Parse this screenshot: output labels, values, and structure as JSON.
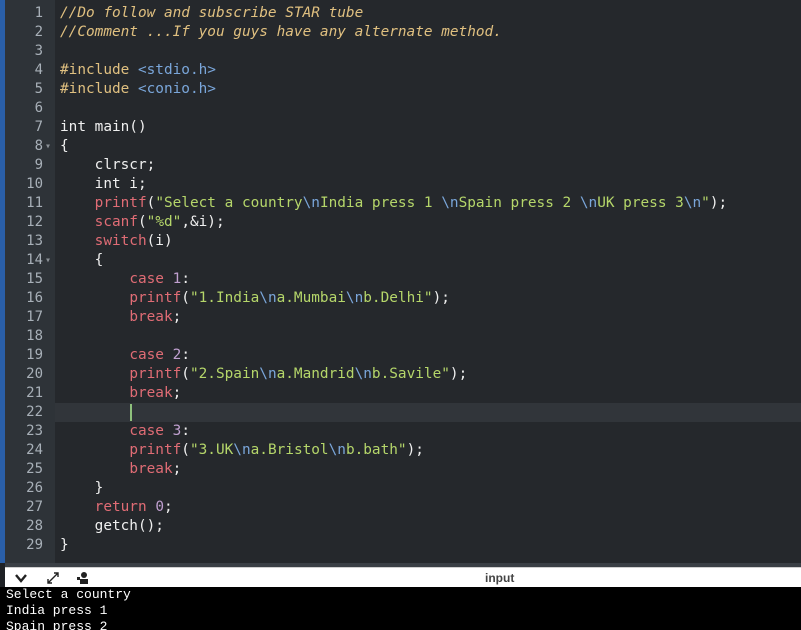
{
  "editor": {
    "lines": [
      {
        "num": "1",
        "tokens": [
          {
            "t": "//Do follow and subscribe STAR tube",
            "c": "comment"
          }
        ]
      },
      {
        "num": "2",
        "tokens": [
          {
            "t": "//Comment ...If you guys have any alternate method.",
            "c": "comment"
          }
        ]
      },
      {
        "num": "3",
        "tokens": []
      },
      {
        "num": "4",
        "tokens": [
          {
            "t": "#include ",
            "c": "pre"
          },
          {
            "t": "<stdio.h>",
            "c": "hdr"
          }
        ]
      },
      {
        "num": "5",
        "tokens": [
          {
            "t": "#include ",
            "c": "pre"
          },
          {
            "t": "<conio.h>",
            "c": "hdr"
          }
        ]
      },
      {
        "num": "6",
        "tokens": []
      },
      {
        "num": "7",
        "tokens": [
          {
            "t": "int main()",
            "c": "plain"
          }
        ]
      },
      {
        "num": "8",
        "fold": true,
        "tokens": [
          {
            "t": "{",
            "c": "plain"
          }
        ]
      },
      {
        "num": "9",
        "tokens": [
          {
            "t": "    clrscr;",
            "c": "plain"
          }
        ]
      },
      {
        "num": "10",
        "tokens": [
          {
            "t": "    int i;",
            "c": "plain"
          }
        ]
      },
      {
        "num": "11",
        "tokens": [
          {
            "t": "    ",
            "c": "plain"
          },
          {
            "t": "printf",
            "c": "fn"
          },
          {
            "t": "(",
            "c": "plain"
          },
          {
            "t": "\"Select a country",
            "c": "str"
          },
          {
            "t": "\\n",
            "c": "esc"
          },
          {
            "t": "India press 1 ",
            "c": "str"
          },
          {
            "t": "\\n",
            "c": "esc"
          },
          {
            "t": "Spain press 2 ",
            "c": "str"
          },
          {
            "t": "\\n",
            "c": "esc"
          },
          {
            "t": "UK press 3",
            "c": "str"
          },
          {
            "t": "\\n",
            "c": "esc"
          },
          {
            "t": "\"",
            "c": "str"
          },
          {
            "t": ");",
            "c": "plain"
          }
        ]
      },
      {
        "num": "12",
        "tokens": [
          {
            "t": "    ",
            "c": "plain"
          },
          {
            "t": "scanf",
            "c": "fn"
          },
          {
            "t": "(",
            "c": "plain"
          },
          {
            "t": "\"%d\"",
            "c": "str"
          },
          {
            "t": ",&i);",
            "c": "plain"
          }
        ]
      },
      {
        "num": "13",
        "tokens": [
          {
            "t": "    ",
            "c": "plain"
          },
          {
            "t": "switch",
            "c": "fn"
          },
          {
            "t": "(i)",
            "c": "plain"
          }
        ]
      },
      {
        "num": "14",
        "fold": true,
        "tokens": [
          {
            "t": "    {",
            "c": "plain"
          }
        ]
      },
      {
        "num": "15",
        "tokens": [
          {
            "t": "        ",
            "c": "plain"
          },
          {
            "t": "case",
            "c": "fn"
          },
          {
            "t": " ",
            "c": "plain"
          },
          {
            "t": "1",
            "c": "num"
          },
          {
            "t": ":",
            "c": "plain"
          }
        ]
      },
      {
        "num": "16",
        "tokens": [
          {
            "t": "        ",
            "c": "plain"
          },
          {
            "t": "printf",
            "c": "fn"
          },
          {
            "t": "(",
            "c": "plain"
          },
          {
            "t": "\"1.India",
            "c": "str"
          },
          {
            "t": "\\n",
            "c": "esc"
          },
          {
            "t": "a.Mumbai",
            "c": "str"
          },
          {
            "t": "\\n",
            "c": "esc"
          },
          {
            "t": "b.Delhi\"",
            "c": "str"
          },
          {
            "t": ");",
            "c": "plain"
          }
        ]
      },
      {
        "num": "17",
        "tokens": [
          {
            "t": "        ",
            "c": "plain"
          },
          {
            "t": "break",
            "c": "fn"
          },
          {
            "t": ";",
            "c": "plain"
          }
        ]
      },
      {
        "num": "18",
        "tokens": []
      },
      {
        "num": "19",
        "tokens": [
          {
            "t": "        ",
            "c": "plain"
          },
          {
            "t": "case",
            "c": "fn"
          },
          {
            "t": " ",
            "c": "plain"
          },
          {
            "t": "2",
            "c": "num"
          },
          {
            "t": ":",
            "c": "plain"
          }
        ]
      },
      {
        "num": "20",
        "tokens": [
          {
            "t": "        ",
            "c": "plain"
          },
          {
            "t": "printf",
            "c": "fn"
          },
          {
            "t": "(",
            "c": "plain"
          },
          {
            "t": "\"2.Spain",
            "c": "str"
          },
          {
            "t": "\\n",
            "c": "esc"
          },
          {
            "t": "a.Mandrid",
            "c": "str"
          },
          {
            "t": "\\n",
            "c": "esc"
          },
          {
            "t": "b.Savile\"",
            "c": "str"
          },
          {
            "t": ");",
            "c": "plain"
          }
        ]
      },
      {
        "num": "21",
        "tokens": [
          {
            "t": "        ",
            "c": "plain"
          },
          {
            "t": "break",
            "c": "fn"
          },
          {
            "t": ";",
            "c": "plain"
          }
        ]
      },
      {
        "num": "22",
        "active": true,
        "tokens": []
      },
      {
        "num": "23",
        "tokens": [
          {
            "t": "        ",
            "c": "plain"
          },
          {
            "t": "case",
            "c": "fn"
          },
          {
            "t": " ",
            "c": "plain"
          },
          {
            "t": "3",
            "c": "num"
          },
          {
            "t": ":",
            "c": "plain"
          }
        ]
      },
      {
        "num": "24",
        "tokens": [
          {
            "t": "        ",
            "c": "plain"
          },
          {
            "t": "printf",
            "c": "fn"
          },
          {
            "t": "(",
            "c": "plain"
          },
          {
            "t": "\"3.UK",
            "c": "str"
          },
          {
            "t": "\\n",
            "c": "esc"
          },
          {
            "t": "a.Bristol",
            "c": "str"
          },
          {
            "t": "\\n",
            "c": "esc"
          },
          {
            "t": "b.bath\"",
            "c": "str"
          },
          {
            "t": ");",
            "c": "plain"
          }
        ]
      },
      {
        "num": "25",
        "tokens": [
          {
            "t": "        ",
            "c": "plain"
          },
          {
            "t": "break",
            "c": "fn"
          },
          {
            "t": ";",
            "c": "plain"
          }
        ]
      },
      {
        "num": "26",
        "tokens": [
          {
            "t": "    }",
            "c": "plain"
          }
        ]
      },
      {
        "num": "27",
        "tokens": [
          {
            "t": "    ",
            "c": "plain"
          },
          {
            "t": "return",
            "c": "fn"
          },
          {
            "t": " ",
            "c": "plain"
          },
          {
            "t": "0",
            "c": "num"
          },
          {
            "t": ";",
            "c": "plain"
          }
        ]
      },
      {
        "num": "28",
        "tokens": [
          {
            "t": "    getch();",
            "c": "plain"
          }
        ]
      },
      {
        "num": "29",
        "tokens": [
          {
            "t": "}",
            "c": "plain"
          }
        ]
      }
    ]
  },
  "io_panel": {
    "title": "input",
    "icons": [
      "chevron-down-icon",
      "expand-icon",
      "person-icon"
    ]
  },
  "console": {
    "lines": [
      "Select a country",
      "India press 1",
      "Spain press 2"
    ]
  }
}
